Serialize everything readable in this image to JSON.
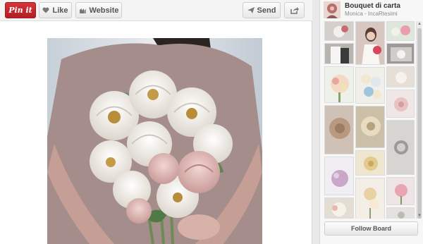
{
  "toolbar": {
    "pinit_label": "Pin it",
    "like_label": "Like",
    "website_label": "Website",
    "send_label": "Send",
    "share_icon": "share-icon"
  },
  "pin": {
    "image_subject": "paper flower bouquet"
  },
  "board": {
    "title": "Bouquet di carta",
    "subtitle": "Monica - IncaRtesimi",
    "follow_label": "Follow Board"
  },
  "colors": {
    "pinit_red": "#c8232c",
    "background": "#e9e9e9",
    "panel": "#f7f7f7"
  }
}
